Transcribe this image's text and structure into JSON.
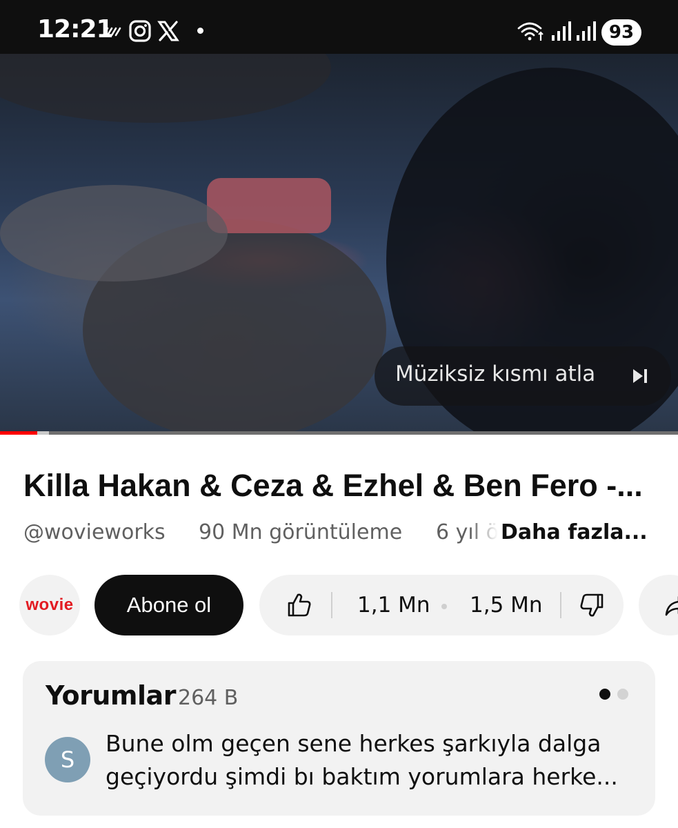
{
  "status_bar": {
    "time": "12:21",
    "battery": "93",
    "icons": [
      "shortcut-icon",
      "instagram-icon",
      "x-icon",
      "notification-dot",
      "wifi-icon",
      "signal-icon",
      "signal-icon"
    ]
  },
  "player": {
    "skip_button_label": "Müziksiz kısmı atla",
    "skip_icon": "skip-next-icon",
    "progress_fraction": 0.055,
    "buffered_fraction": 0.072,
    "progress_color": "#ff0000"
  },
  "video": {
    "title": "Killa Hakan & Ceza & Ezhel & Ben Fero -...",
    "channel_handle": "@wovieworks",
    "views": "90 Mn görüntüleme",
    "age": "6 yıl ö",
    "more_label": "Daha fazla..."
  },
  "channel": {
    "avatar_text": "wovie",
    "brand_color": "#e21b22"
  },
  "actions": {
    "subscribe_label": "Abone ol",
    "like_count": "1,1 Mn",
    "dislike_count": "1,5 Mn"
  },
  "comments": {
    "title": "Yorumlar",
    "count": "264 B",
    "first_comment": {
      "avatar_letter": "S",
      "line1": "Bune olm geçen sene herkes şarkıyla dalga",
      "line2": "geçiyordu şimdi bı baktım yorumlara herke..."
    }
  }
}
